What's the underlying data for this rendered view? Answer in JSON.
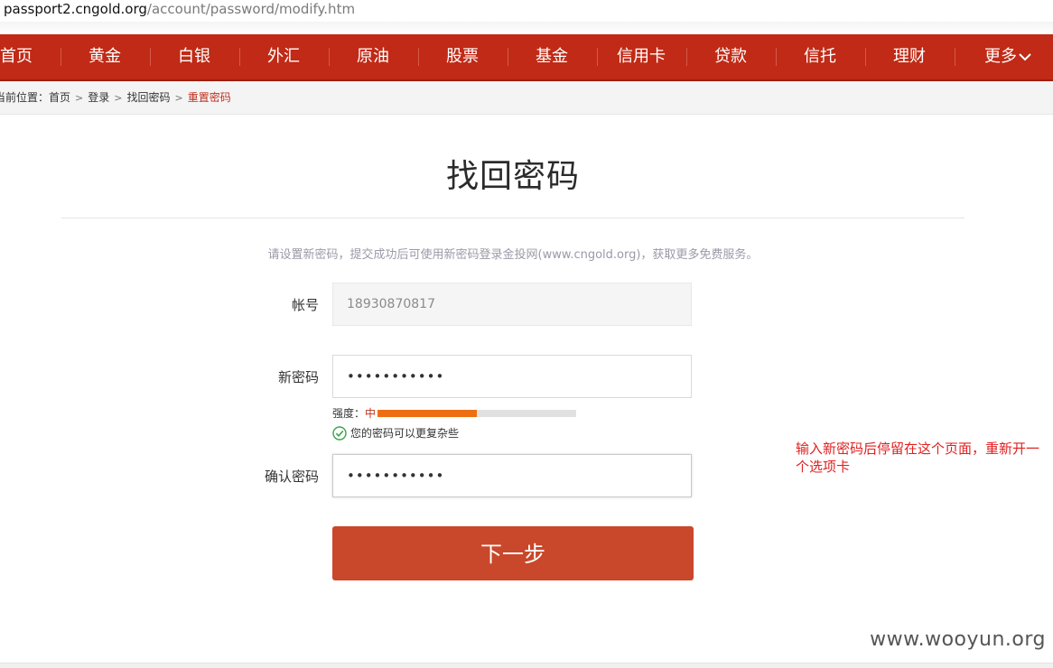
{
  "address_bar": {
    "host": "passport2.cngold.org",
    "path": "/account/password/modify.htm"
  },
  "nav": {
    "items": [
      "首页",
      "黄金",
      "白银",
      "外汇",
      "原油",
      "股票",
      "基金",
      "信用卡",
      "贷款",
      "信托",
      "理财"
    ],
    "more_label": "更多"
  },
  "breadcrumb": {
    "prefix": "当前位置：",
    "items": [
      "首页",
      "登录",
      "找回密码"
    ],
    "current": "重置密码"
  },
  "page": {
    "title": "找回密码",
    "tip": "请设置新密码，提交成功后可使用新密码登录金投网(www.cngold.org)，获取更多免费服务。"
  },
  "form": {
    "account": {
      "label": "帐号",
      "value": "18930870817"
    },
    "new_password": {
      "label": "新密码",
      "value": "•••••••••••"
    },
    "strength": {
      "label": "强度：",
      "level": "中",
      "fill_fraction": 0.5,
      "fill_color": "#ee6e13"
    },
    "hint": "您的密码可以更复杂些",
    "confirm_password": {
      "label": "确认密码",
      "value": "•••••••••••"
    },
    "submit_label": "下一步"
  },
  "annotation": {
    "text": "输入新密码后停留在这个页面，重新开一个选项卡"
  },
  "watermark": "www.wooyun.org",
  "colors": {
    "nav_bg": "#c02a16",
    "button_bg": "#c9472a",
    "accent_red": "#c0301f",
    "annotation_red": "#e02020",
    "success_green": "#3aa54a"
  }
}
